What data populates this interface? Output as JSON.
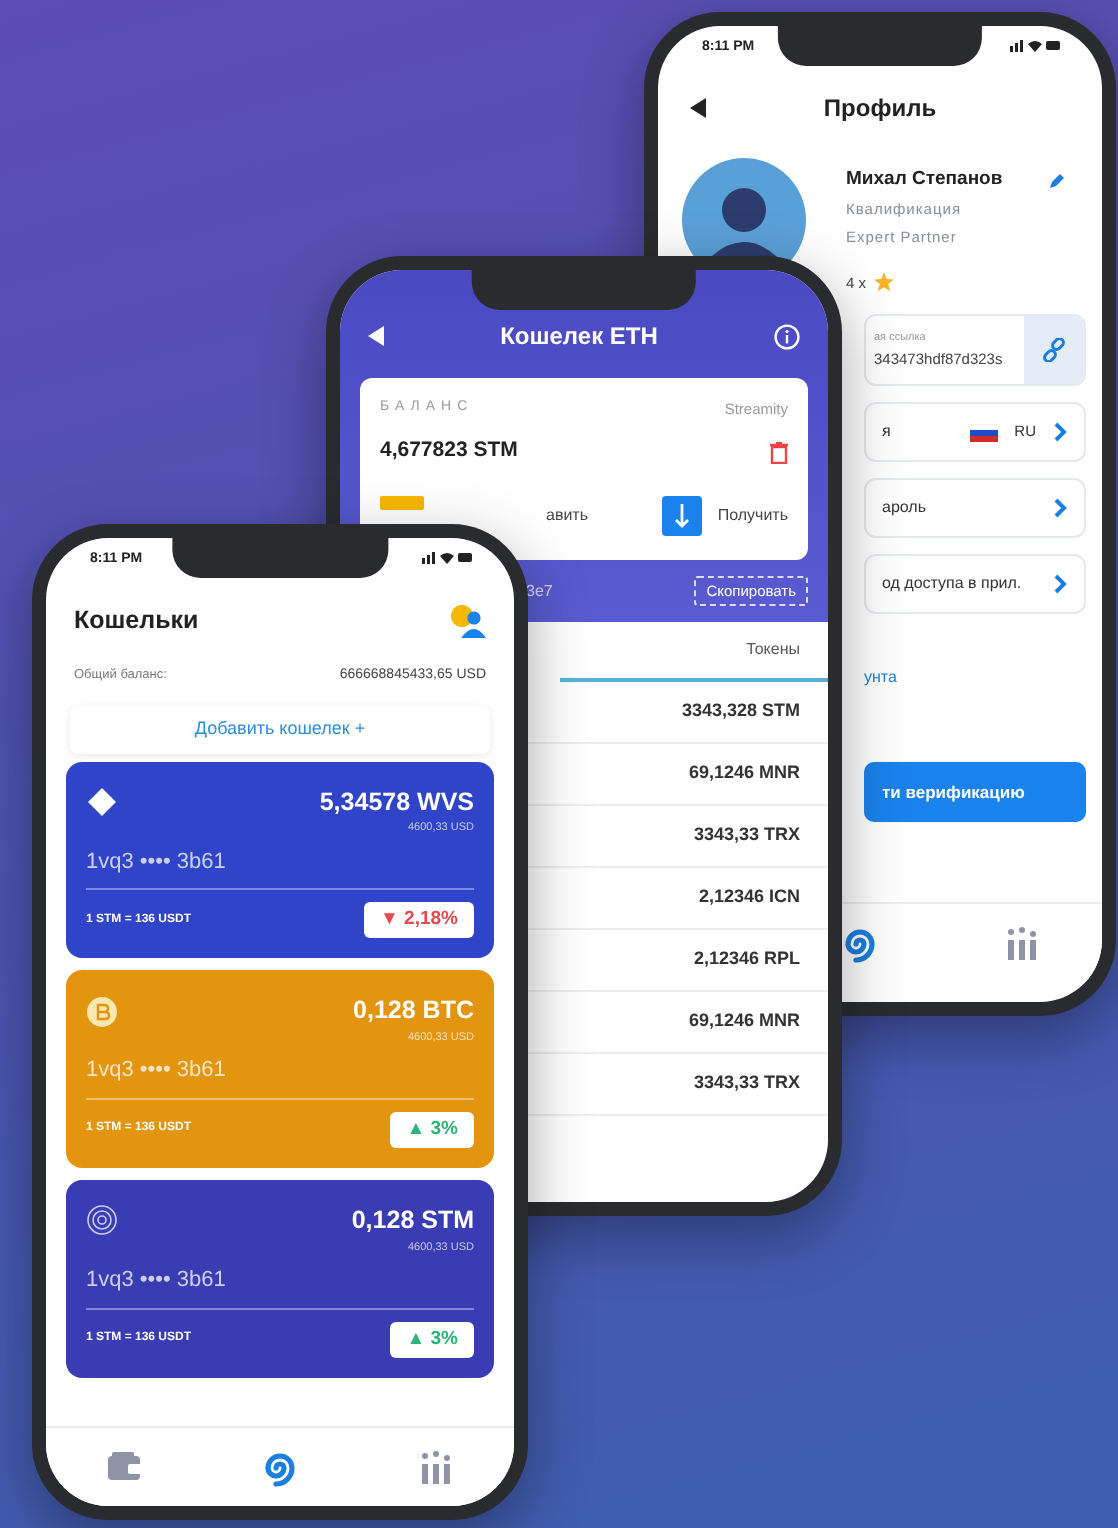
{
  "profile_screen": {
    "status_time": "8:11 PM",
    "title": "Профиль",
    "name": "Михал Степанов",
    "qualification_label": "Квалификация",
    "qualification": "Expert Partner",
    "rating": "4 x",
    "referral": {
      "label": "ая ссылка",
      "value": "343473hdf87d323s"
    },
    "settings": [
      {
        "kind": "language",
        "label": "я",
        "value": "RU"
      },
      {
        "kind": "nav",
        "label": "ароль"
      },
      {
        "kind": "nav",
        "label": "од доступа в прил."
      }
    ],
    "link": "унта",
    "button": "ти верификацию",
    "tab_bar": [
      {
        "selected": true
      },
      {
        "selected": false
      }
    ]
  },
  "eth_screen": {
    "title": "Кошелек ETH",
    "balance_label": "БАЛАНС",
    "provider": "Streamity",
    "balance": "4,677823 STM",
    "send_label": "авить",
    "receive_label": "Получить",
    "address": "3e7",
    "copy_button": "Скопировать",
    "tabs": [
      {
        "label": "Токены",
        "selected": true
      }
    ],
    "tokens": [
      "3343,328 STM",
      "69,1246 MNR",
      "3343,33 TRX",
      "2,12346 ICN",
      "2,12346 RPL",
      "69,1246 MNR",
      "3343,33 TRX"
    ]
  },
  "wallets_screen": {
    "status_time": "8:11 PM",
    "title": "Кошельки",
    "total_label": "Общий баланс:",
    "total": "666668845433,65 USD",
    "add_button": "Добавить кошелек +",
    "wallets": [
      {
        "amount": "5,34578 WVS",
        "fiat": "4600,33 USD",
        "address": "1vq3 •••• 3b61",
        "rate": "1 STM = 136 USDT",
        "change": "▼ 2,18%",
        "declining": true,
        "color": "#2f44c8"
      },
      {
        "amount": "0,128 BTC",
        "fiat": "4600,33 USD",
        "address": "1vq3 •••• 3b61",
        "rate": "1 STM = 136 USDT",
        "change": "▲ 3%",
        "declining": false,
        "color": "#e3950f"
      },
      {
        "amount": "0,128 STM",
        "fiat": "4600,33 USD",
        "address": "1vq3 •••• 3b61",
        "rate": "1 STM = 136 USDT",
        "change": "▲ 3%",
        "declining": false,
        "color": "#3a3cb4"
      }
    ],
    "tab_bar": [
      {
        "selected": false
      },
      {
        "selected": true
      },
      {
        "selected": false
      }
    ]
  }
}
